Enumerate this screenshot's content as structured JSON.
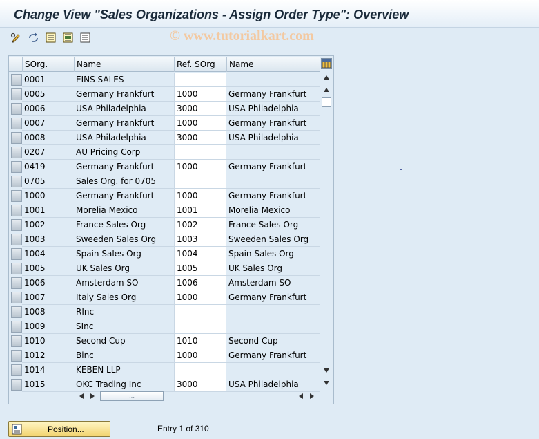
{
  "window": {
    "title": "Change View \"Sales Organizations - Assign Order Type\": Overview",
    "watermark": "© www.tutorialkart.com"
  },
  "toolbar": {
    "icons": [
      "display-change-icon",
      "refresh-icon",
      "select-all-icon",
      "select-block-icon",
      "deselect-all-icon"
    ]
  },
  "table": {
    "columns": [
      "SOrg.",
      "Name",
      "Ref. SOrg",
      "Name"
    ],
    "rows": [
      {
        "sorg": "0001",
        "name": "EINS SALES",
        "ref": "",
        "ref_name": ""
      },
      {
        "sorg": "0005",
        "name": "Germany Frankfurt",
        "ref": "1000",
        "ref_name": "Germany Frankfurt"
      },
      {
        "sorg": "0006",
        "name": "USA Philadelphia",
        "ref": "3000",
        "ref_name": "USA Philadelphia"
      },
      {
        "sorg": "0007",
        "name": "Germany Frankfurt",
        "ref": "1000",
        "ref_name": "Germany Frankfurt"
      },
      {
        "sorg": "0008",
        "name": "USA Philadelphia",
        "ref": "3000",
        "ref_name": "USA Philadelphia"
      },
      {
        "sorg": "0207",
        "name": "AU Pricing Corp",
        "ref": "",
        "ref_name": ""
      },
      {
        "sorg": "0419",
        "name": "Germany Frankfurt",
        "ref": "1000",
        "ref_name": "Germany Frankfurt"
      },
      {
        "sorg": "0705",
        "name": "Sales Org. for 0705",
        "ref": "",
        "ref_name": ""
      },
      {
        "sorg": "1000",
        "name": "Germany Frankfurt",
        "ref": "1000",
        "ref_name": "Germany Frankfurt"
      },
      {
        "sorg": "1001",
        "name": "Morelia Mexico",
        "ref": "1001",
        "ref_name": "Morelia Mexico"
      },
      {
        "sorg": "1002",
        "name": "France Sales Org",
        "ref": "1002",
        "ref_name": "France Sales Org"
      },
      {
        "sorg": "1003",
        "name": "Sweeden Sales Org",
        "ref": "1003",
        "ref_name": "Sweeden Sales Org"
      },
      {
        "sorg": "1004",
        "name": "Spain Sales Org",
        "ref": "1004",
        "ref_name": "Spain Sales Org"
      },
      {
        "sorg": "1005",
        "name": "UK Sales Org",
        "ref": "1005",
        "ref_name": "UK Sales Org"
      },
      {
        "sorg": "1006",
        "name": "Amsterdam SO",
        "ref": "1006",
        "ref_name": "Amsterdam SO"
      },
      {
        "sorg": "1007",
        "name": "Italy Sales Org",
        "ref": "1000",
        "ref_name": "Germany Frankfurt"
      },
      {
        "sorg": "1008",
        "name": "RInc",
        "ref": "",
        "ref_name": ""
      },
      {
        "sorg": "1009",
        "name": "SInc",
        "ref": "",
        "ref_name": ""
      },
      {
        "sorg": "1010",
        "name": "Second Cup",
        "ref": "1010",
        "ref_name": "Second Cup"
      },
      {
        "sorg": "1012",
        "name": "Binc",
        "ref": "1000",
        "ref_name": "Germany Frankfurt"
      },
      {
        "sorg": "1014",
        "name": "KEBEN LLP",
        "ref": "",
        "ref_name": ""
      },
      {
        "sorg": "1015",
        "name": "OKC Trading Inc",
        "ref": "3000",
        "ref_name": "USA Philadelphia"
      }
    ]
  },
  "footer": {
    "position_label": "Position...",
    "entry_text": "Entry 1 of 310"
  }
}
